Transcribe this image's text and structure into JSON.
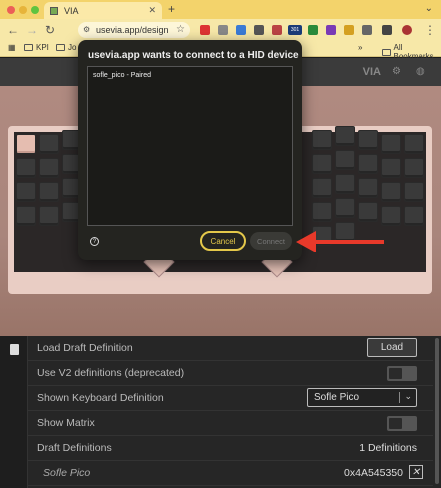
{
  "browser": {
    "tab_title": "VIA",
    "tab_favicon": "via-icon",
    "url": "usevia.app/design",
    "bookmarks": [
      "KPI",
      "Jo"
    ],
    "all_bookmarks": "All Bookmarks",
    "extension_badge": "301",
    "overflow": "»"
  },
  "via": {
    "logo": "VIA"
  },
  "dialog": {
    "title": "usevia.app wants to connect to a HID device",
    "device": "sofle_pico - Paired",
    "cancel": "Cancel",
    "connect": "Connect"
  },
  "settings": {
    "rows": [
      {
        "label": "Load Draft Definition",
        "button": "Load"
      },
      {
        "label": "Use V2 definitions (deprecated)"
      },
      {
        "label": "Shown Keyboard Definition",
        "select": "Sofle Pico"
      },
      {
        "label": "Show Matrix"
      },
      {
        "label": "Draft Definitions",
        "value": "1 Definitions"
      },
      {
        "label": "Sofle Pico",
        "value": "0x4A545350",
        "remove": "✕"
      }
    ]
  },
  "colors": {
    "tabbar": "#f3d36b",
    "accent_yellow": "#e4c84a",
    "arrow": "#e8392a",
    "key_highlight": "#e5bdb0"
  }
}
